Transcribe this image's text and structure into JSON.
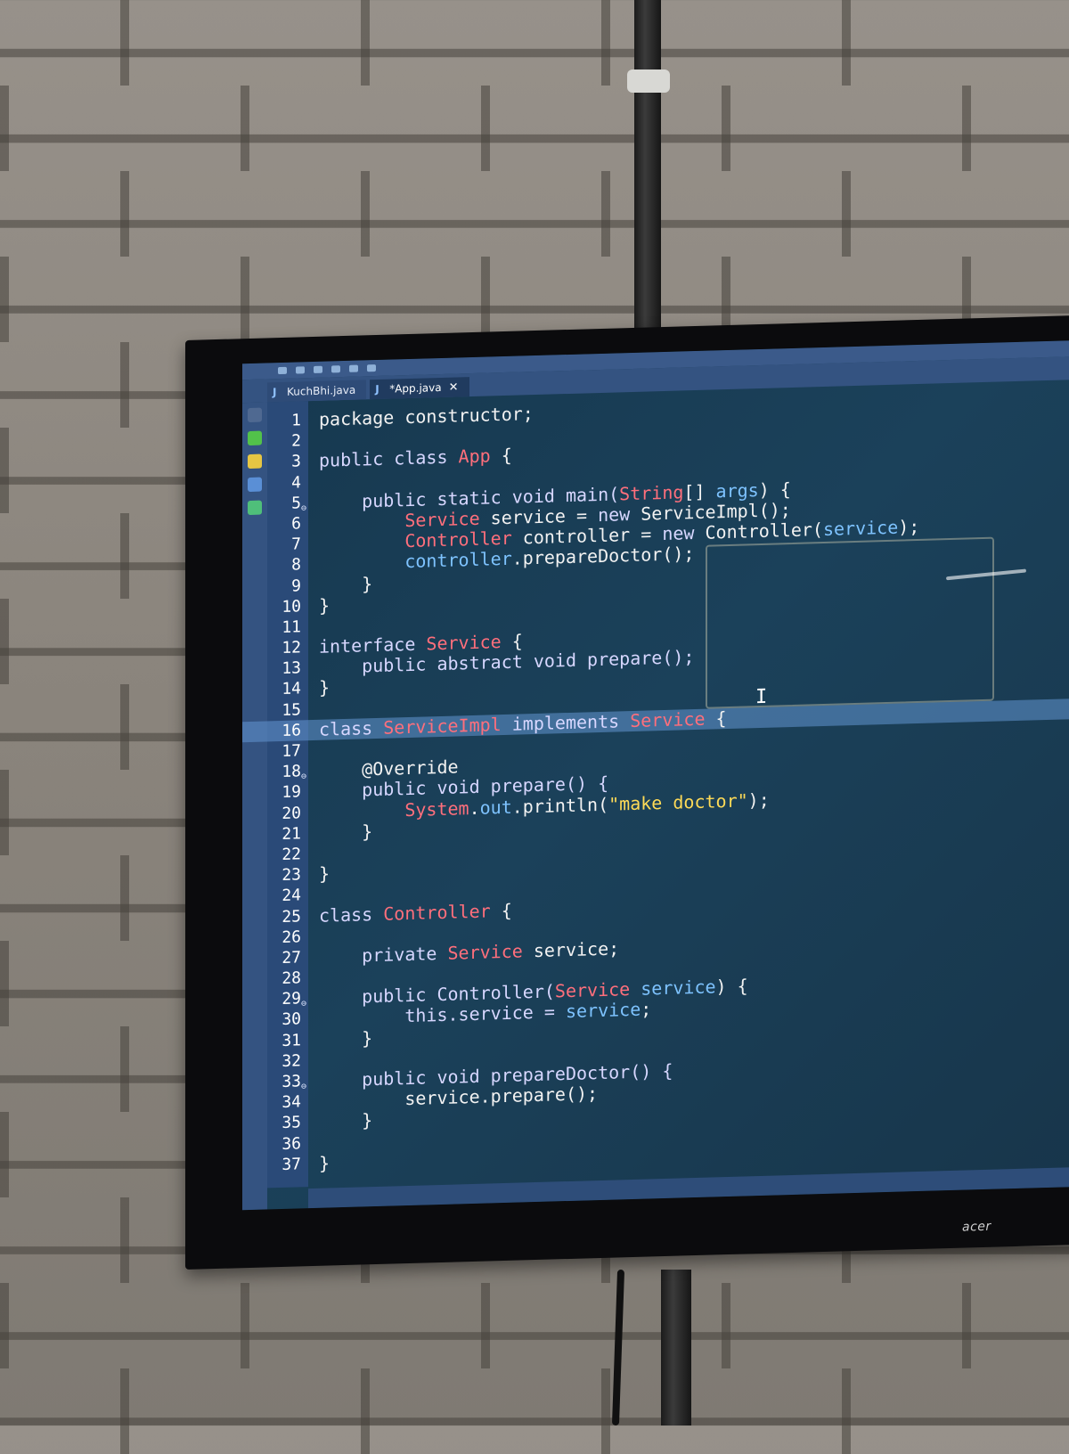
{
  "ide": {
    "tabs": [
      {
        "label": "KuchBhi.java",
        "active": false
      },
      {
        "label": "*App.java",
        "active": true
      }
    ],
    "tab_close_glyph": "✕",
    "brand": "acer",
    "current_line": 16,
    "colors": {
      "screen_bg": "#17384f",
      "keyword": "#d7d7ff",
      "type": "#ff6f7c",
      "field": "#7ec3ff",
      "string": "#ffdb57",
      "current_line_bg": "#5d8fca"
    }
  },
  "editor": {
    "lines": [
      {
        "n": "1",
        "tokens": [
          {
            "t": "package constructor;",
            "c": ""
          }
        ]
      },
      {
        "n": "2",
        "tokens": []
      },
      {
        "n": "3",
        "tokens": [
          {
            "t": "public class ",
            "c": "kw"
          },
          {
            "t": "App",
            "c": "type"
          },
          {
            "t": " {",
            "c": ""
          }
        ]
      },
      {
        "n": "4",
        "tokens": []
      },
      {
        "n": "5",
        "marker": "⊖",
        "tokens": [
          {
            "t": "    public static void main(",
            "c": "kw"
          },
          {
            "t": "String",
            "c": "type"
          },
          {
            "t": "[] ",
            "c": ""
          },
          {
            "t": "args",
            "c": "field"
          },
          {
            "t": ") {",
            "c": ""
          }
        ]
      },
      {
        "n": "6",
        "tokens": [
          {
            "t": "        ",
            "c": ""
          },
          {
            "t": "Service",
            "c": "type"
          },
          {
            "t": " service = ",
            "c": ""
          },
          {
            "t": "new",
            "c": "kw"
          },
          {
            "t": " ServiceImpl();",
            "c": ""
          }
        ]
      },
      {
        "n": "7",
        "tokens": [
          {
            "t": "        ",
            "c": ""
          },
          {
            "t": "Controller",
            "c": "type"
          },
          {
            "t": " controller = ",
            "c": ""
          },
          {
            "t": "new",
            "c": "kw"
          },
          {
            "t": " Controller(",
            "c": ""
          },
          {
            "t": "service",
            "c": "field"
          },
          {
            "t": ");",
            "c": ""
          }
        ]
      },
      {
        "n": "8",
        "tokens": [
          {
            "t": "        ",
            "c": ""
          },
          {
            "t": "controller",
            "c": "field"
          },
          {
            "t": ".prepareDoctor();",
            "c": ""
          }
        ]
      },
      {
        "n": "9",
        "tokens": [
          {
            "t": "    }",
            "c": ""
          }
        ]
      },
      {
        "n": "10",
        "tokens": [
          {
            "t": "}",
            "c": ""
          }
        ]
      },
      {
        "n": "11",
        "tokens": []
      },
      {
        "n": "12",
        "tokens": [
          {
            "t": "interface ",
            "c": "kw"
          },
          {
            "t": "Service",
            "c": "type"
          },
          {
            "t": " {",
            "c": ""
          }
        ]
      },
      {
        "n": "13",
        "tokens": [
          {
            "t": "    public abstract void prepare();",
            "c": "kw"
          }
        ]
      },
      {
        "n": "14",
        "tokens": [
          {
            "t": "}",
            "c": ""
          }
        ]
      },
      {
        "n": "15",
        "tokens": []
      },
      {
        "n": "16",
        "tokens": [
          {
            "t": "class ",
            "c": "kw"
          },
          {
            "t": "ServiceImpl",
            "c": "type"
          },
          {
            "t": " implements ",
            "c": "kw"
          },
          {
            "t": "Service",
            "c": "type"
          },
          {
            "t": " {",
            "c": ""
          }
        ]
      },
      {
        "n": "17",
        "tokens": []
      },
      {
        "n": "18",
        "marker": "⊖",
        "tokens": [
          {
            "t": "    @Override",
            "c": ""
          }
        ]
      },
      {
        "n": "19",
        "tokens": [
          {
            "t": "    public void prepare() {",
            "c": "kw"
          }
        ]
      },
      {
        "n": "20",
        "tokens": [
          {
            "t": "        ",
            "c": ""
          },
          {
            "t": "System",
            "c": "type"
          },
          {
            "t": ".",
            "c": ""
          },
          {
            "t": "out",
            "c": "field"
          },
          {
            "t": ".println(",
            "c": ""
          },
          {
            "t": "\"make doctor\"",
            "c": "str"
          },
          {
            "t": ");",
            "c": ""
          }
        ]
      },
      {
        "n": "21",
        "tokens": [
          {
            "t": "    }",
            "c": ""
          }
        ]
      },
      {
        "n": "22",
        "tokens": []
      },
      {
        "n": "23",
        "tokens": [
          {
            "t": "}",
            "c": ""
          }
        ]
      },
      {
        "n": "24",
        "tokens": []
      },
      {
        "n": "25",
        "tokens": [
          {
            "t": "class ",
            "c": "kw"
          },
          {
            "t": "Controller",
            "c": "type"
          },
          {
            "t": " {",
            "c": ""
          }
        ]
      },
      {
        "n": "26",
        "tokens": []
      },
      {
        "n": "27",
        "tokens": [
          {
            "t": "    private ",
            "c": "kw"
          },
          {
            "t": "Service",
            "c": "type"
          },
          {
            "t": " service;",
            "c": ""
          }
        ]
      },
      {
        "n": "28",
        "tokens": []
      },
      {
        "n": "29",
        "marker": "⊖",
        "tokens": [
          {
            "t": "    public Controller(",
            "c": "kw"
          },
          {
            "t": "Service",
            "c": "type"
          },
          {
            "t": " ",
            "c": ""
          },
          {
            "t": "service",
            "c": "field"
          },
          {
            "t": ") {",
            "c": ""
          }
        ]
      },
      {
        "n": "30",
        "tokens": [
          {
            "t": "        this.service = ",
            "c": "kw"
          },
          {
            "t": "service",
            "c": "field"
          },
          {
            "t": ";",
            "c": ""
          }
        ]
      },
      {
        "n": "31",
        "tokens": [
          {
            "t": "    }",
            "c": ""
          }
        ]
      },
      {
        "n": "32",
        "tokens": []
      },
      {
        "n": "33",
        "marker": "⊖",
        "tokens": [
          {
            "t": "    public void prepareDoctor() {",
            "c": "kw"
          }
        ]
      },
      {
        "n": "34",
        "tokens": [
          {
            "t": "        service.prepare();",
            "c": ""
          }
        ]
      },
      {
        "n": "35",
        "tokens": [
          {
            "t": "    }",
            "c": ""
          }
        ]
      },
      {
        "n": "36",
        "tokens": []
      },
      {
        "n": "37",
        "tokens": [
          {
            "t": "}",
            "c": ""
          }
        ]
      }
    ]
  }
}
